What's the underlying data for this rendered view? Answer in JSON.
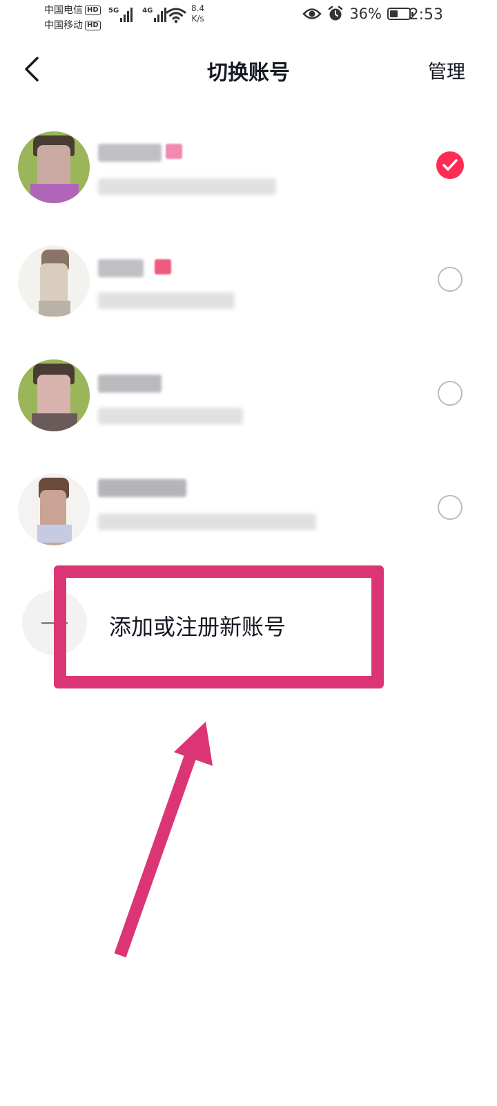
{
  "status_bar": {
    "carrier_1": "中国电信",
    "carrier_2": "中国移动",
    "hd_badge": "HD",
    "net_1": "5G",
    "net_2": "4G",
    "speed_value": "8.4",
    "speed_unit": "K/s",
    "battery_percent": "36%",
    "time": "2:53",
    "icons": [
      "eye-icon",
      "alarm-icon",
      "wifi-icon",
      "battery-icon"
    ]
  },
  "nav": {
    "title": "切换账号",
    "manage": "管理",
    "back_icon": "chevron-left-icon"
  },
  "accounts": [
    {
      "selected": true
    },
    {
      "selected": false
    },
    {
      "selected": false
    },
    {
      "selected": false
    }
  ],
  "add_account": {
    "label": "添加或注册新账号",
    "icon": "plus-icon"
  },
  "colors": {
    "accent": "#fe2c55",
    "annotation": "#dc3575",
    "text": "#161823",
    "radio_border": "#bbbbbb"
  }
}
